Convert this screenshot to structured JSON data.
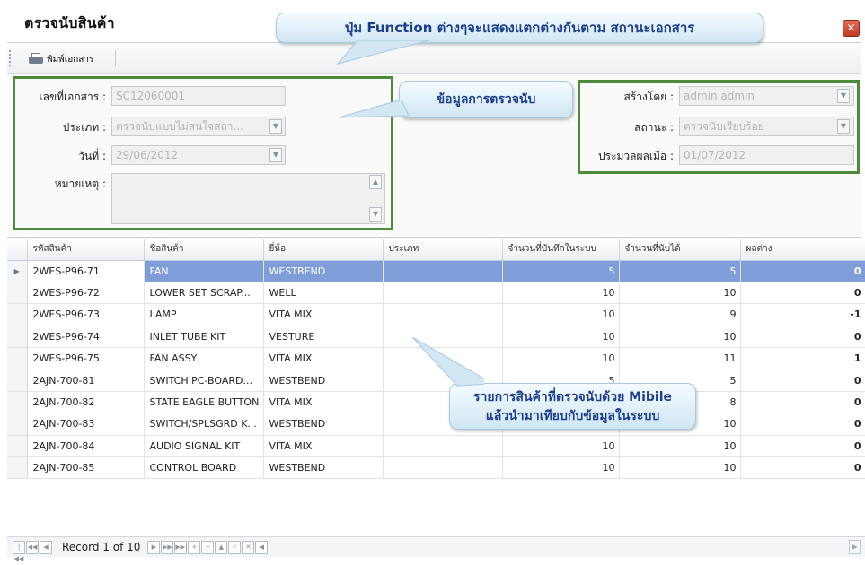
{
  "window": {
    "title": "ตรวจนับสินค้า",
    "close_symbol": "✕"
  },
  "toolbar": {
    "print_label": "พิมพ์เอกสาร"
  },
  "form": {
    "doc_no_label": "เลขที่เอกสาร :",
    "doc_no_value": "SC12060001",
    "type_label": "ประเภท :",
    "type_value": "ตรวจนับแบบไม่สนใจสถา...",
    "date_label": "วันที่ :",
    "date_value": "29/06/2012",
    "note_label": "หมายเหตุ :",
    "note_value": "",
    "created_by_label": "สร้างโดย :",
    "created_by_value": "admin admin",
    "status_label": "สถานะ :",
    "status_value": "ตรวจนับเรียบร้อย",
    "processed_label": "ประมวลผลเมื่อ :",
    "processed_value": "01/07/2012"
  },
  "callouts": {
    "function_note": "ปุ่ม Function ต่างๆจะแสดงแตกต่างกันตาม สถานะเอกสาร",
    "count_info": "ข้อมูลการตรวจนับ",
    "mobile_line1": "รายการสินค้าที่ตรวจนับด้วย Mibile",
    "mobile_line2": "แล้วนำมาเทียบกับข้อมูลในระบบ"
  },
  "grid": {
    "columns": [
      "รหัสสินค้า",
      "ชื่อสินค้า",
      "ยี่ห้อ",
      "ประเภท",
      "จำนวนที่บันทึกในระบบ",
      "จำนวนที่นับได้",
      "ผลต่าง"
    ],
    "rows": [
      {
        "code": "2WES-P96-71",
        "name": "FAN",
        "brand": "WESTBEND",
        "type": "",
        "system_qty": "5",
        "counted_qty": "5",
        "diff": "0"
      },
      {
        "code": "2WES-P96-72",
        "name": "LOWER SET SCRAP...",
        "brand": "WELL",
        "type": "",
        "system_qty": "10",
        "counted_qty": "10",
        "diff": "0"
      },
      {
        "code": "2WES-P96-73",
        "name": "LAMP",
        "brand": "VITA MIX",
        "type": "",
        "system_qty": "10",
        "counted_qty": "9",
        "diff": "-1"
      },
      {
        "code": "2WES-P96-74",
        "name": "INLET TUBE KIT",
        "brand": "VESTURE",
        "type": "",
        "system_qty": "10",
        "counted_qty": "10",
        "diff": "0"
      },
      {
        "code": "2WES-P96-75",
        "name": "FAN ASSY",
        "brand": "VITA MIX",
        "type": "",
        "system_qty": "10",
        "counted_qty": "11",
        "diff": "1"
      },
      {
        "code": "2AJN-700-81",
        "name": "SWITCH PC-BOARD...",
        "brand": "WESTBEND",
        "type": "",
        "system_qty": "5",
        "counted_qty": "5",
        "diff": "0"
      },
      {
        "code": "2AJN-700-82",
        "name": "STATE EAGLE BUTTON",
        "brand": "VITA MIX",
        "type": "",
        "system_qty": "",
        "counted_qty": "8",
        "diff": "0"
      },
      {
        "code": "2AJN-700-83",
        "name": "SWITCH/SPLSGRD K...",
        "brand": "WESTBEND",
        "type": "",
        "system_qty": "",
        "counted_qty": "10",
        "diff": "0"
      },
      {
        "code": "2AJN-700-84",
        "name": "AUDIO SIGNAL KIT",
        "brand": "VITA MIX",
        "type": "",
        "system_qty": "10",
        "counted_qty": "10",
        "diff": "0"
      },
      {
        "code": "2AJN-700-85",
        "name": "CONTROL BOARD",
        "brand": "WESTBEND",
        "type": "",
        "system_qty": "10",
        "counted_qty": "10",
        "diff": "0"
      }
    ]
  },
  "navigator": {
    "record_text": "Record 1 of 10"
  }
}
